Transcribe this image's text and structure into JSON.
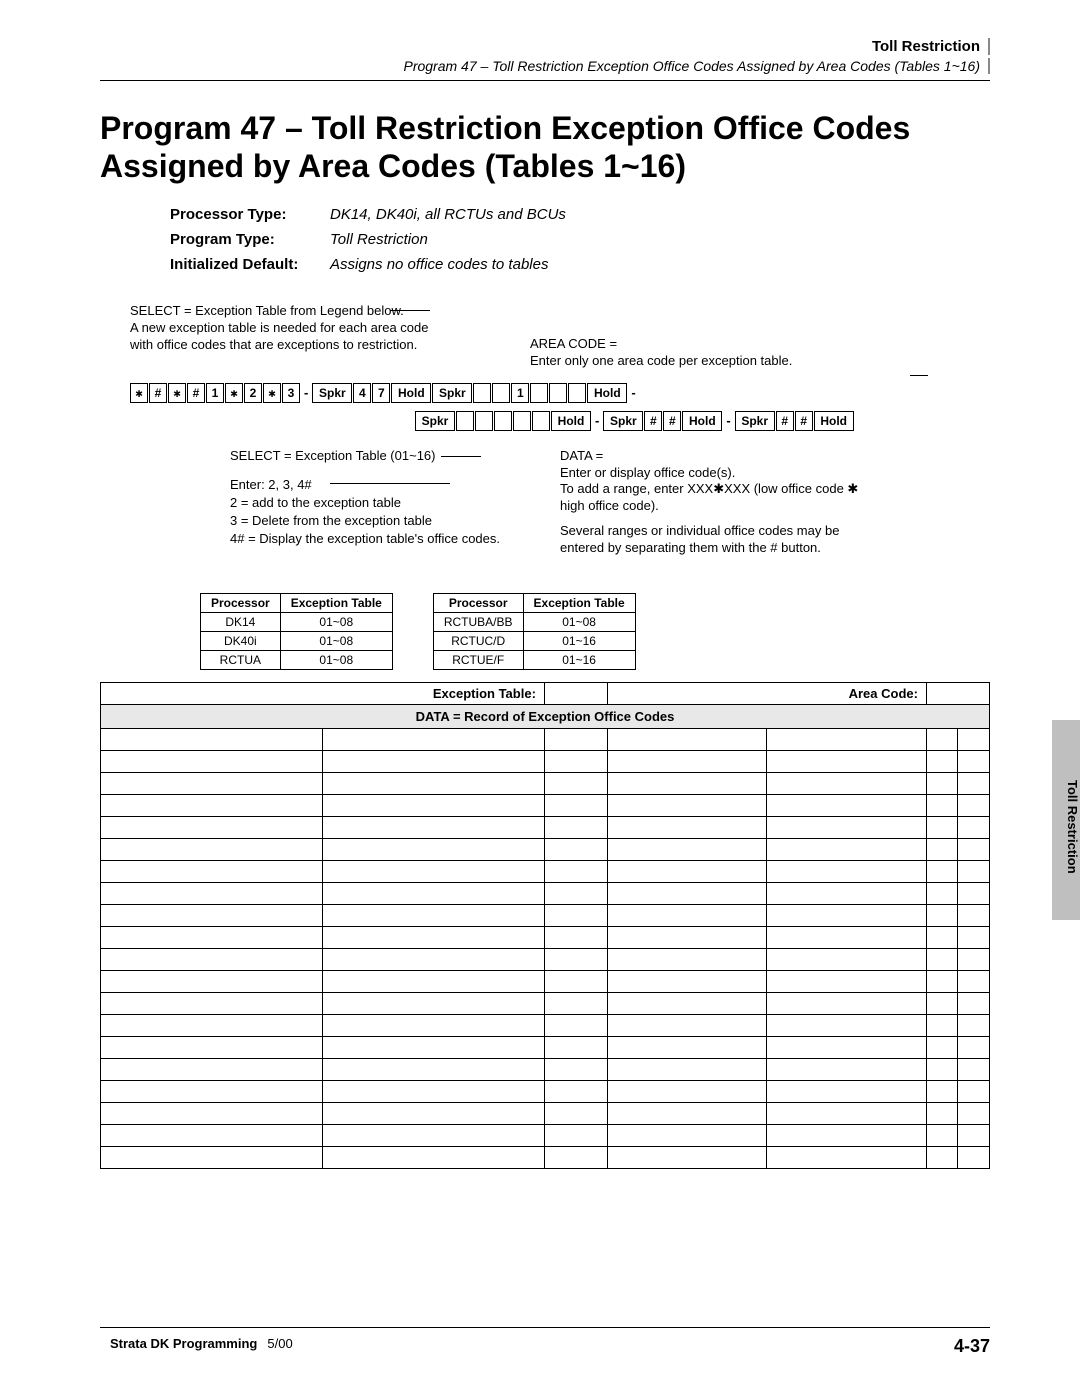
{
  "header": {
    "section": "Toll Restriction",
    "breadcrumb": "Program 47 – Toll Restriction Exception Office Codes Assigned by Area Codes (Tables 1~16)"
  },
  "title": "Program 47 – Toll Restriction Exception Office Codes Assigned by Area Codes (Tables 1~16)",
  "meta": {
    "proc_label": "Processor Type:",
    "proc_val": "DK14, DK40i, all RCTUs and BCUs",
    "prog_label": "Program Type:",
    "prog_val": "Toll Restriction",
    "init_label": "Initialized Default:",
    "init_val": "Assigns no office codes to tables"
  },
  "diag": {
    "select_note1": "SELECT = Exception Table from Legend below.",
    "select_note2": "A new exception table is needed for each area code with office codes that are exceptions to restriction.",
    "areacode1": "AREA CODE =",
    "areacode2": "Enter only one area code per exception table.",
    "select2": "SELECT = Exception Table (01~16)",
    "enter_hdr": "Enter: 2, 3, 4#",
    "enter2": "2 =   add to the exception table",
    "enter3": "3 =   Delete from the exception table",
    "enter4": "4# =  Display the exception table's office codes.",
    "data1": "DATA =",
    "data2": "Enter or display office code(s).",
    "range": "To add a range, enter XXX✱XXX (low office code ✱ high office code).",
    "sep": "Several ranges or individual office codes may be entered by separating them with the # button."
  },
  "kb": {
    "star": "✱",
    "hash": "#",
    "one": "1",
    "two": "2",
    "three": "3",
    "spkr": "Spkr",
    "four": "4",
    "seven": "7",
    "hold": "Hold",
    "dash": "-"
  },
  "proc_tables": [
    {
      "headers": [
        "Processor",
        "Exception Table"
      ],
      "rows": [
        [
          "DK14",
          "01~08"
        ],
        [
          "DK40i",
          "01~08"
        ],
        [
          "RCTUA",
          "01~08"
        ]
      ]
    },
    {
      "headers": [
        "Processor",
        "Exception Table"
      ],
      "rows": [
        [
          "RCTUBA/BB",
          "01~08"
        ],
        [
          "RCTUC/D",
          "01~16"
        ],
        [
          "RCTUE/F",
          "01~16"
        ]
      ]
    }
  ],
  "main_table": {
    "exc_label": "Exception Table:",
    "area_label": "Area Code:",
    "data_header": "DATA = Record of Exception Office Codes",
    "blank_rows": 20,
    "cols": 7
  },
  "side": "Toll Restriction",
  "footer": {
    "left_bold": "Strata DK Programming",
    "left_date": "5/00",
    "right": "4-37"
  }
}
